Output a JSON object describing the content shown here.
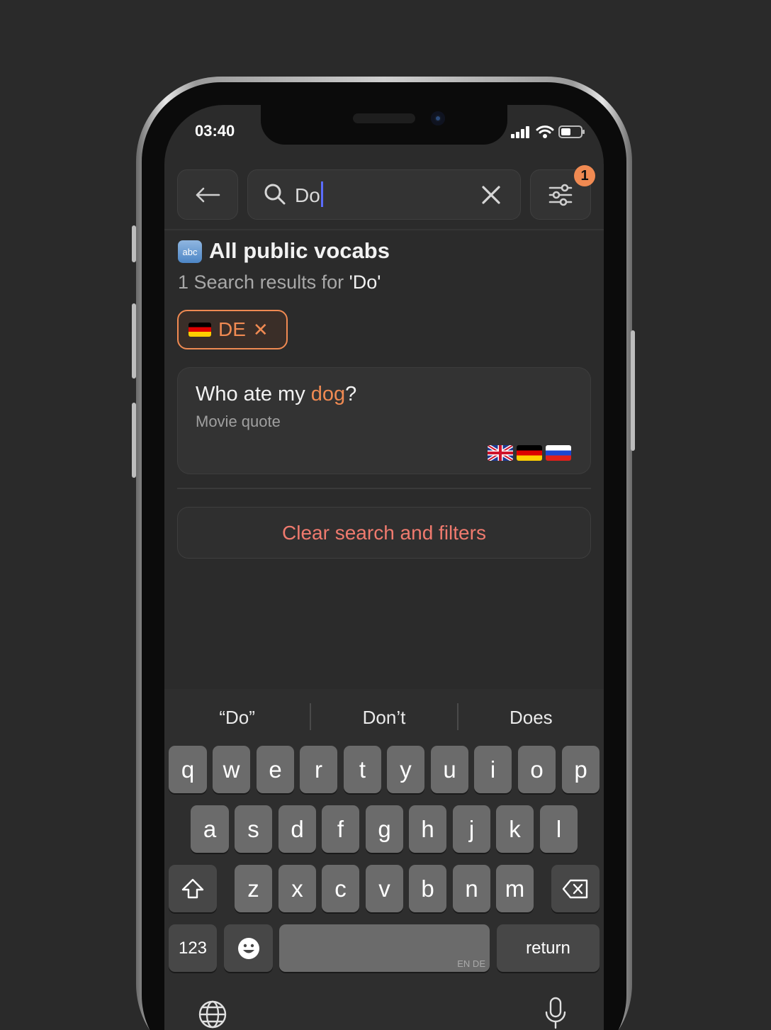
{
  "status": {
    "time": "03:40"
  },
  "search": {
    "value": "Do"
  },
  "filter": {
    "badge_count": "1"
  },
  "header": {
    "icon_label": "abc",
    "title": "All public vocabs",
    "subtitle_prefix": "1 Search results for ",
    "subtitle_query": "'Do'"
  },
  "chip": {
    "label": "DE",
    "remove_glyph": "✕"
  },
  "results": [
    {
      "title_before": "Who ate my ",
      "title_highlight": "dog",
      "title_after": "?",
      "subtitle": "Movie quote",
      "flags": [
        "flag-gb-icon",
        "flag-de-icon",
        "flag-ru-icon"
      ]
    }
  ],
  "clear_button": {
    "label": "Clear search and filters"
  },
  "keyboard": {
    "suggestions": [
      "“Do”",
      "Don’t",
      "Does"
    ],
    "row1": [
      "q",
      "w",
      "e",
      "r",
      "t",
      "y",
      "u",
      "i",
      "o",
      "p"
    ],
    "row2": [
      "a",
      "s",
      "d",
      "f",
      "g",
      "h",
      "j",
      "k",
      "l"
    ],
    "row3": [
      "z",
      "x",
      "c",
      "v",
      "b",
      "n",
      "m"
    ],
    "numbers_label": "123",
    "return_label": "return",
    "space_languages": "EN DE"
  },
  "colors": {
    "accent": "#f08a52",
    "clear": "#ef7a6e",
    "background": "#2b2b2b"
  }
}
